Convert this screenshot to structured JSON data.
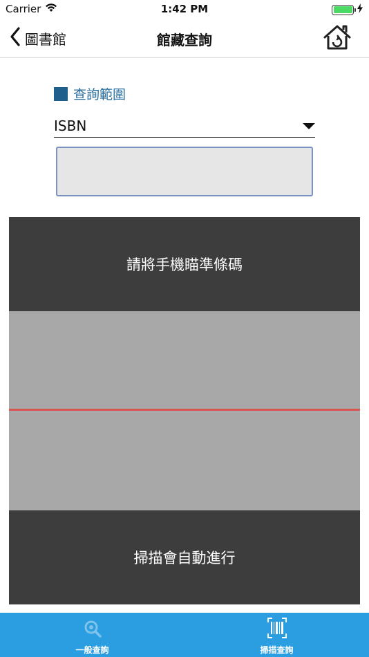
{
  "status_bar": {
    "carrier": "Carrier",
    "time": "1:42 PM",
    "battery_level": 1.0,
    "battery_color": "#4cd964"
  },
  "nav": {
    "back_label": "圖書館",
    "title": "館藏查詢",
    "home_icon": "home-icon"
  },
  "search": {
    "scope_label": "查詢範圍",
    "scope_square_color": "#1f5f8b",
    "scope_value": "ISBN",
    "input_value": ""
  },
  "scanner": {
    "top_text": "請將手機瞄準條碼",
    "bottom_text": "掃描會自動進行",
    "line_color": "#d9534f"
  },
  "tabs": [
    {
      "label": "一般查詢",
      "icon": "magnifier-icon",
      "active": false
    },
    {
      "label": "掃描查詢",
      "icon": "barcode-scan-icon",
      "active": true
    }
  ],
  "colors": {
    "tab_bar": "#2a9ee0",
    "tab_inactive_text": "#ffffff",
    "tab_active_text": "#ffffff",
    "accent": "#2a6f9e"
  }
}
